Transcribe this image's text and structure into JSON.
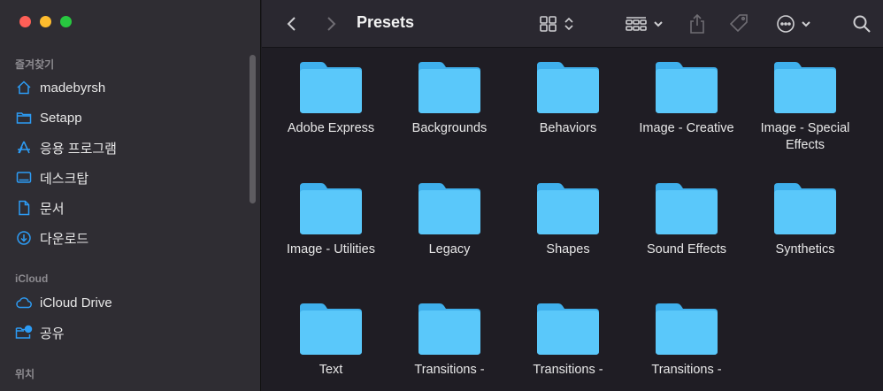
{
  "window": {
    "title": "Presets"
  },
  "sidebar": {
    "favorites_header": "즐겨찾기",
    "favorites": [
      {
        "label": "madebyrsh",
        "icon": "home-icon"
      },
      {
        "label": "Setapp",
        "icon": "folder-icon"
      },
      {
        "label": "응용 프로그램",
        "icon": "applications-icon"
      },
      {
        "label": "데스크탑",
        "icon": "desktop-icon"
      },
      {
        "label": "문서",
        "icon": "document-icon"
      },
      {
        "label": "다운로드",
        "icon": "download-icon"
      }
    ],
    "icloud_header": "iCloud",
    "icloud": [
      {
        "label": "iCloud Drive",
        "icon": "cloud-icon"
      },
      {
        "label": "공유",
        "icon": "shared-folder-icon"
      }
    ],
    "locations_header": "위치"
  },
  "files": [
    {
      "name": "Adobe Express"
    },
    {
      "name": "Backgrounds"
    },
    {
      "name": "Behaviors"
    },
    {
      "name": "Image - Creative"
    },
    {
      "name": "Image - Special Effects"
    },
    {
      "name": "Image - Utilities"
    },
    {
      "name": "Legacy"
    },
    {
      "name": "Shapes"
    },
    {
      "name": "Sound Effects"
    },
    {
      "name": "Synthetics"
    },
    {
      "name": "Text"
    },
    {
      "name": "Transitions -"
    },
    {
      "name": "Transitions -"
    },
    {
      "name": "Transitions -"
    }
  ],
  "colors": {
    "accent": "#2d9cf5",
    "folder_front": "#5ac8fa",
    "folder_back": "#3fb0ec"
  }
}
